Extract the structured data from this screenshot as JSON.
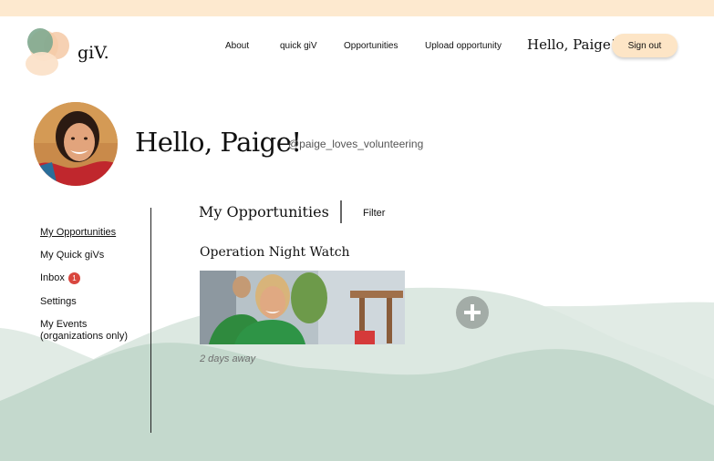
{
  "header": {
    "logo_text": "giV.",
    "nav": [
      "About",
      "quick giV",
      "Opportunities",
      "Upload opportunity"
    ],
    "greeting": "Hello, Paige!",
    "sign_out": "Sign out"
  },
  "profile": {
    "greeting": "Hello, Paige!",
    "handle": "@paige_loves_volunteering"
  },
  "sidebar": {
    "items": [
      {
        "label": "My Opportunities",
        "active": true
      },
      {
        "label": "My Quick giVs"
      },
      {
        "label": "Inbox",
        "badge": "1"
      },
      {
        "label": "Settings"
      },
      {
        "label": "My Events"
      }
    ],
    "events_sub": "(organizations only)"
  },
  "main": {
    "title": "My Opportunities",
    "filter_label": "Filter",
    "opportunity": {
      "title": "Operation Night Watch",
      "time": "2 days away"
    }
  },
  "colors": {
    "top_strip": "#fde9cf",
    "button_bg": "#fde5c6",
    "badge": "#d9473f",
    "wave_light": "#dbe7e1",
    "wave_dark": "#c4d9cd",
    "add_button": "#a3aca7"
  },
  "icons": {
    "add": "plus-icon",
    "logo": "blob-logo-icon"
  }
}
